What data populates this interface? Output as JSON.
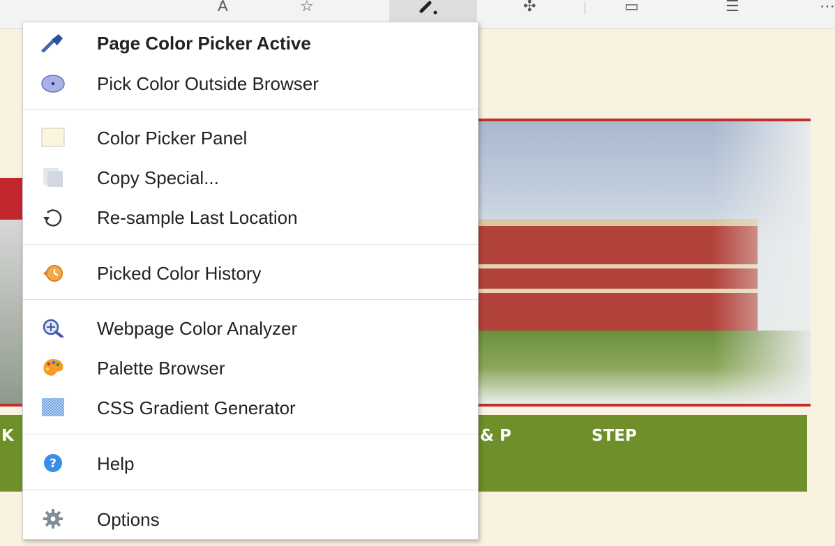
{
  "menu": {
    "items": [
      {
        "label": "Page Color Picker Active",
        "icon": "eyedropper-icon"
      },
      {
        "label": "Pick Color Outside Browser",
        "icon": "pick-outside-icon"
      },
      {
        "label": "Color Picker Panel",
        "icon": "color-swatch-icon"
      },
      {
        "label": "Copy Special...",
        "icon": "copy-icon"
      },
      {
        "label": "Re-sample Last Location",
        "icon": "resample-icon"
      },
      {
        "label": "Picked Color History",
        "icon": "history-icon"
      },
      {
        "label": "Webpage Color Analyzer",
        "icon": "analyzer-icon"
      },
      {
        "label": "Palette Browser",
        "icon": "palette-icon"
      },
      {
        "label": "CSS Gradient Generator",
        "icon": "gradient-icon"
      },
      {
        "label": "Help",
        "icon": "help-icon"
      },
      {
        "label": "Options",
        "icon": "gear-icon"
      }
    ]
  },
  "page": {
    "nav_fragment_left": "K",
    "nav_fragment_mid": "& P",
    "nav_fragment_step": "STEP"
  },
  "colors": {
    "page_background": "#f9f2e0",
    "nav_bar": "#6e8f2a",
    "accent_red": "#c0302c",
    "swatch": "#fbf5df"
  }
}
